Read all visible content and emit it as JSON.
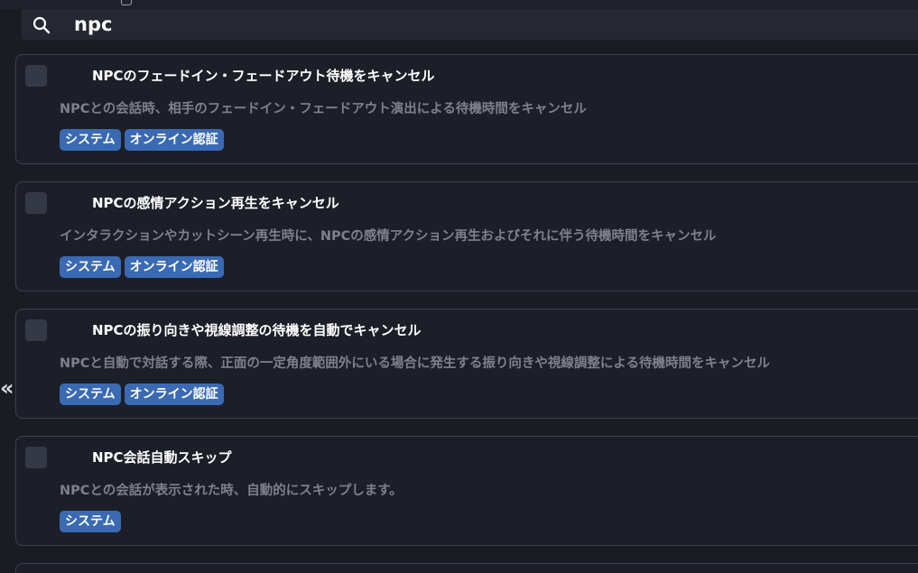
{
  "search": {
    "query": "npc",
    "icon": "search-icon"
  },
  "sidebar_toggle": {
    "label": "«"
  },
  "results": [
    {
      "title": "NPCのフェードイン・フェードアウト待機をキャンセル",
      "description": "NPCとの会話時、相手のフェードイン・フェードアウト演出による待機時間をキャンセル",
      "tags": [
        "システム",
        "オンライン認証"
      ]
    },
    {
      "title": "NPCの感情アクション再生をキャンセル",
      "description": "インタラクションやカットシーン再生時に、NPCの感情アクション再生およびそれに伴う待機時間をキャンセル",
      "tags": [
        "システム",
        "オンライン認証"
      ]
    },
    {
      "title": "NPCの振り向きや視線調整の待機を自動でキャンセル",
      "description": "NPCと自動で対話する際、正面の一定角度範囲外にいる場合に発生する振り向きや視線調整による待機時間をキャンセル",
      "tags": [
        "システム",
        "オンライン認証"
      ]
    },
    {
      "title": "NPC会話自動スキップ",
      "description": "NPCとの会話が表示された時、自動的にスキップします。",
      "tags": [
        "システム"
      ]
    }
  ],
  "colors": {
    "background": "#1a1c24",
    "card_border": "#3d414d",
    "tag_background": "#3a6ab3",
    "description_text": "#7d818b"
  }
}
